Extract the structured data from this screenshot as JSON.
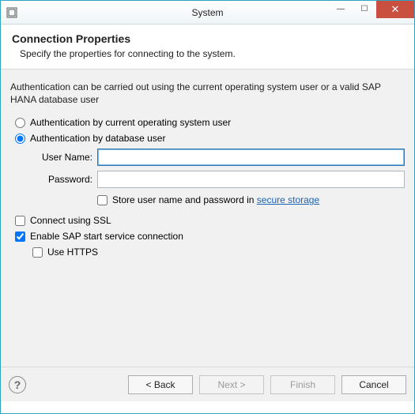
{
  "window": {
    "title": "System"
  },
  "header": {
    "title": "Connection Properties",
    "subtitle": "Specify the properties for connecting to the system."
  },
  "auth": {
    "description": "Authentication can be carried out using the current operating system user or a valid SAP HANA database user",
    "radio_os": "Authentication by current operating system user",
    "radio_db": "Authentication by database user",
    "selected": "db",
    "username_label": "User Name:",
    "username_value": "",
    "password_label": "Password:",
    "password_value": "",
    "store_prefix": "Store user name and password in ",
    "store_link": "secure storage",
    "store_checked": false
  },
  "ssl": {
    "label": "Connect using SSL",
    "checked": false
  },
  "sap_service": {
    "label": "Enable SAP start service connection",
    "checked": true,
    "https_label": "Use HTTPS",
    "https_checked": false
  },
  "footer": {
    "back": "< Back",
    "next": "Next >",
    "finish": "Finish",
    "cancel": "Cancel"
  }
}
